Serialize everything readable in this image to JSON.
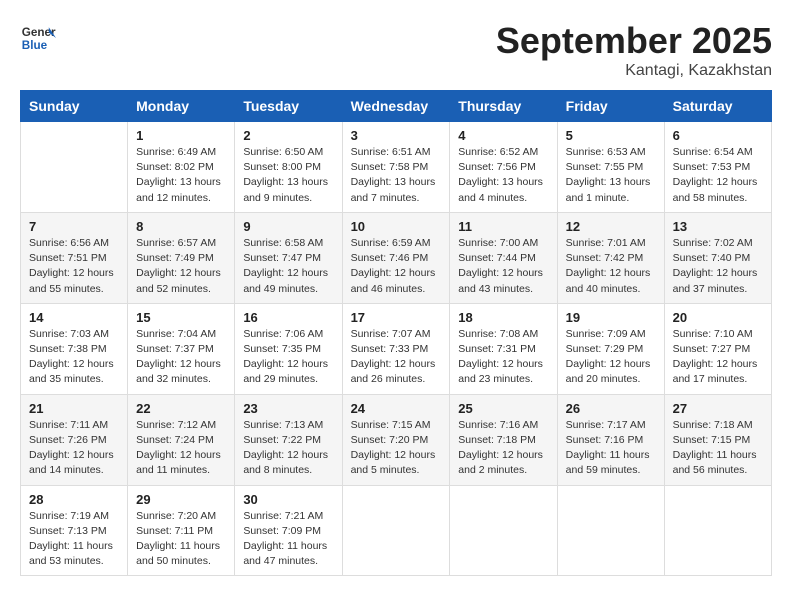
{
  "header": {
    "logo_line1": "General",
    "logo_line2": "Blue",
    "month": "September 2025",
    "location": "Kantagi, Kazakhstan"
  },
  "days_of_week": [
    "Sunday",
    "Monday",
    "Tuesday",
    "Wednesday",
    "Thursday",
    "Friday",
    "Saturday"
  ],
  "weeks": [
    [
      {
        "day": "",
        "info": ""
      },
      {
        "day": "1",
        "info": "Sunrise: 6:49 AM\nSunset: 8:02 PM\nDaylight: 13 hours\nand 12 minutes."
      },
      {
        "day": "2",
        "info": "Sunrise: 6:50 AM\nSunset: 8:00 PM\nDaylight: 13 hours\nand 9 minutes."
      },
      {
        "day": "3",
        "info": "Sunrise: 6:51 AM\nSunset: 7:58 PM\nDaylight: 13 hours\nand 7 minutes."
      },
      {
        "day": "4",
        "info": "Sunrise: 6:52 AM\nSunset: 7:56 PM\nDaylight: 13 hours\nand 4 minutes."
      },
      {
        "day": "5",
        "info": "Sunrise: 6:53 AM\nSunset: 7:55 PM\nDaylight: 13 hours\nand 1 minute."
      },
      {
        "day": "6",
        "info": "Sunrise: 6:54 AM\nSunset: 7:53 PM\nDaylight: 12 hours\nand 58 minutes."
      }
    ],
    [
      {
        "day": "7",
        "info": "Sunrise: 6:56 AM\nSunset: 7:51 PM\nDaylight: 12 hours\nand 55 minutes."
      },
      {
        "day": "8",
        "info": "Sunrise: 6:57 AM\nSunset: 7:49 PM\nDaylight: 12 hours\nand 52 minutes."
      },
      {
        "day": "9",
        "info": "Sunrise: 6:58 AM\nSunset: 7:47 PM\nDaylight: 12 hours\nand 49 minutes."
      },
      {
        "day": "10",
        "info": "Sunrise: 6:59 AM\nSunset: 7:46 PM\nDaylight: 12 hours\nand 46 minutes."
      },
      {
        "day": "11",
        "info": "Sunrise: 7:00 AM\nSunset: 7:44 PM\nDaylight: 12 hours\nand 43 minutes."
      },
      {
        "day": "12",
        "info": "Sunrise: 7:01 AM\nSunset: 7:42 PM\nDaylight: 12 hours\nand 40 minutes."
      },
      {
        "day": "13",
        "info": "Sunrise: 7:02 AM\nSunset: 7:40 PM\nDaylight: 12 hours\nand 37 minutes."
      }
    ],
    [
      {
        "day": "14",
        "info": "Sunrise: 7:03 AM\nSunset: 7:38 PM\nDaylight: 12 hours\nand 35 minutes."
      },
      {
        "day": "15",
        "info": "Sunrise: 7:04 AM\nSunset: 7:37 PM\nDaylight: 12 hours\nand 32 minutes."
      },
      {
        "day": "16",
        "info": "Sunrise: 7:06 AM\nSunset: 7:35 PM\nDaylight: 12 hours\nand 29 minutes."
      },
      {
        "day": "17",
        "info": "Sunrise: 7:07 AM\nSunset: 7:33 PM\nDaylight: 12 hours\nand 26 minutes."
      },
      {
        "day": "18",
        "info": "Sunrise: 7:08 AM\nSunset: 7:31 PM\nDaylight: 12 hours\nand 23 minutes."
      },
      {
        "day": "19",
        "info": "Sunrise: 7:09 AM\nSunset: 7:29 PM\nDaylight: 12 hours\nand 20 minutes."
      },
      {
        "day": "20",
        "info": "Sunrise: 7:10 AM\nSunset: 7:27 PM\nDaylight: 12 hours\nand 17 minutes."
      }
    ],
    [
      {
        "day": "21",
        "info": "Sunrise: 7:11 AM\nSunset: 7:26 PM\nDaylight: 12 hours\nand 14 minutes."
      },
      {
        "day": "22",
        "info": "Sunrise: 7:12 AM\nSunset: 7:24 PM\nDaylight: 12 hours\nand 11 minutes."
      },
      {
        "day": "23",
        "info": "Sunrise: 7:13 AM\nSunset: 7:22 PM\nDaylight: 12 hours\nand 8 minutes."
      },
      {
        "day": "24",
        "info": "Sunrise: 7:15 AM\nSunset: 7:20 PM\nDaylight: 12 hours\nand 5 minutes."
      },
      {
        "day": "25",
        "info": "Sunrise: 7:16 AM\nSunset: 7:18 PM\nDaylight: 12 hours\nand 2 minutes."
      },
      {
        "day": "26",
        "info": "Sunrise: 7:17 AM\nSunset: 7:16 PM\nDaylight: 11 hours\nand 59 minutes."
      },
      {
        "day": "27",
        "info": "Sunrise: 7:18 AM\nSunset: 7:15 PM\nDaylight: 11 hours\nand 56 minutes."
      }
    ],
    [
      {
        "day": "28",
        "info": "Sunrise: 7:19 AM\nSunset: 7:13 PM\nDaylight: 11 hours\nand 53 minutes."
      },
      {
        "day": "29",
        "info": "Sunrise: 7:20 AM\nSunset: 7:11 PM\nDaylight: 11 hours\nand 50 minutes."
      },
      {
        "day": "30",
        "info": "Sunrise: 7:21 AM\nSunset: 7:09 PM\nDaylight: 11 hours\nand 47 minutes."
      },
      {
        "day": "",
        "info": ""
      },
      {
        "day": "",
        "info": ""
      },
      {
        "day": "",
        "info": ""
      },
      {
        "day": "",
        "info": ""
      }
    ]
  ]
}
